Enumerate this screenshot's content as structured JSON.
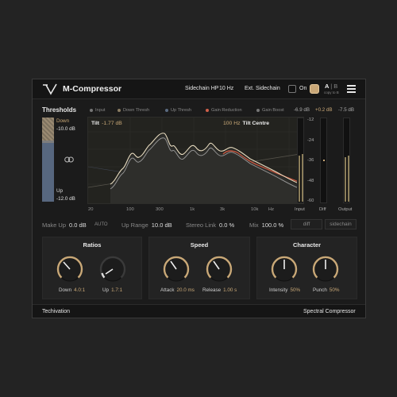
{
  "header": {
    "title": "M-Compressor",
    "sidechain_hp_label": "Sidechain HP",
    "sidechain_hp_value": "10 Hz",
    "ext_sidechain_label": "Ext. Sidechain",
    "on_label": "On",
    "ab_a": "A",
    "ab_sep": "|",
    "ab_b": "B",
    "ab_sub": "copy to B"
  },
  "thresholds": {
    "title": "Thresholds",
    "down_label": "Down",
    "down_value": "-10.0 dB",
    "up_label": "Up",
    "up_value": "-12.0 dB"
  },
  "legend": [
    {
      "label": "Input",
      "color": "#777777"
    },
    {
      "label": "Down Thresh",
      "color": "#8a7c62"
    },
    {
      "label": "Up Thresh",
      "color": "#5a6a80"
    },
    {
      "label": "Gain Reduction",
      "color": "#d0604a"
    },
    {
      "label": "Gain Boost",
      "color": "#777777"
    }
  ],
  "graph": {
    "tilt_label": "Tilt",
    "tilt_value": "-1.77 dB",
    "centre_value": "100 Hz",
    "centre_label": "Tilt Centre",
    "db_scale": [
      "-12",
      "-24",
      "-36",
      "-48",
      "-60"
    ],
    "freq_ticks": [
      "20",
      "100",
      "300",
      "1k",
      "3k",
      "10k",
      "Hz"
    ]
  },
  "meters": {
    "input_label": "Input",
    "input_value": "-6.9 dB",
    "diff_label": "Diff",
    "diff_value": "+0.2 dB",
    "output_label": "Output",
    "output_value": "-7.5 dB"
  },
  "params": {
    "makeup_label": "Make Up",
    "makeup_value": "0.0 dB",
    "auto_label": "AUTO",
    "uprange_label": "Up Range",
    "uprange_value": "10.0 dB",
    "stereolink_label": "Stereo Link",
    "stereolink_value": "0.0 %",
    "mix_label": "Mix",
    "mix_value": "100.0 %",
    "diff_btn": "diff",
    "sidechain_btn": "sidechain"
  },
  "ratios": {
    "title": "Ratios",
    "down_label": "Down",
    "down_value": "4.0:1",
    "up_label": "Up",
    "up_value": "1.7:1"
  },
  "speed": {
    "title": "Speed",
    "attack_label": "Attack",
    "attack_value": "20.0 ms",
    "release_label": "Release",
    "release_value": "1.00 s"
  },
  "character": {
    "title": "Character",
    "intensity_label": "Intensity",
    "intensity_value": "50%",
    "punch_label": "Punch",
    "punch_value": "50%"
  },
  "footer": {
    "brand": "Techivation",
    "product": "Spectral Compressor"
  },
  "colors": {
    "accent": "#c9a877",
    "panel": "#1b1b1b",
    "background": "#232323",
    "gain_reduction": "#d0604a"
  }
}
